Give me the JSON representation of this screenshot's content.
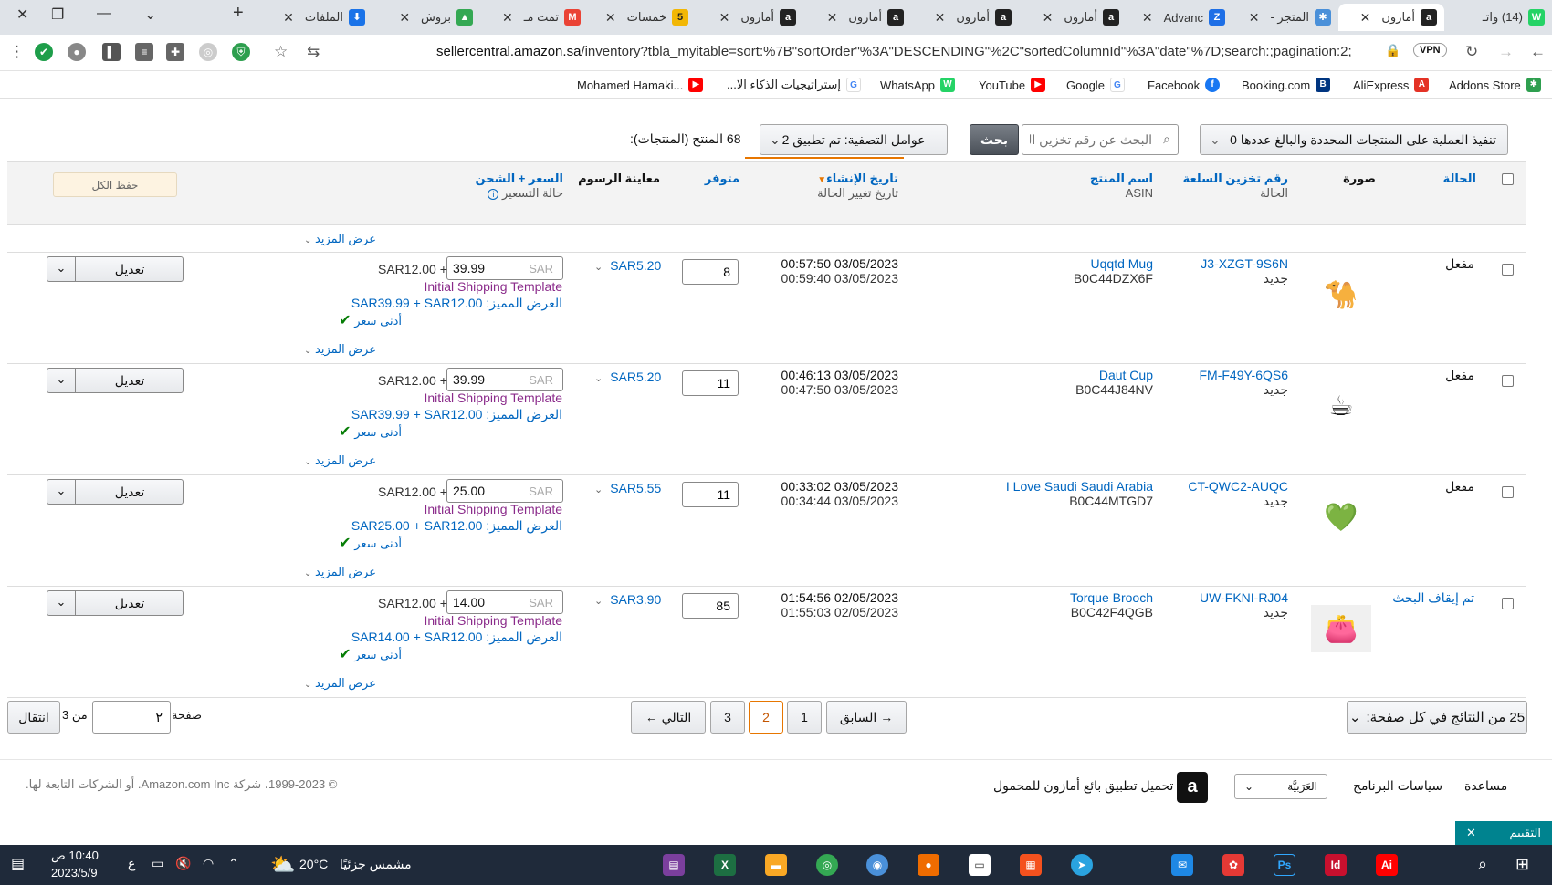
{
  "browser": {
    "tabs": [
      {
        "label": "(14) واتـ",
        "fav": "W"
      },
      {
        "label": "أمازون",
        "fav": "a"
      },
      {
        "label": "المتجر -",
        "fav": "✱"
      },
      {
        "label": "Advanc",
        "fav": "Z"
      },
      {
        "label": "أمازون",
        "fav": "a"
      },
      {
        "label": "أمازون",
        "fav": "a"
      },
      {
        "label": "أمازون",
        "fav": "a"
      },
      {
        "label": "أمازون",
        "fav": "a"
      },
      {
        "label": "خمسات",
        "fav": "5"
      },
      {
        "label": "تمت مـ",
        "fav": "M"
      },
      {
        "label": "بروش",
        "fav": "▲"
      },
      {
        "label": "الملفات",
        "fav": "⬇"
      }
    ],
    "url_domain": "sellercentral.amazon.sa",
    "url_path": "/inventory?tbla_myitable=sort:%7B\"sortOrder\"%3A\"DESCENDING\"%2C\"sortedColumnId\"%3A\"date\"%7D;search:;pagination:2;",
    "bookmarks": [
      "Addons Store",
      "AliExpress",
      "Booking.com",
      "Facebook",
      "Google",
      "YouTube",
      "WhatsApp",
      "إستراتيجيات الذكاء الا...",
      "Mohamed Hamaki..."
    ],
    "accent": "#0066c0"
  },
  "toolbar": {
    "bulk_action": "تنفيذ العملية على المنتجات المحددة والبالغ عددها 0",
    "search_placeholder": "البحث عن رقم تخزين السلعة",
    "search_button": "بحث",
    "filter_button": "عوامل التصفية: تم تطبيق 2",
    "count_text": "68 المنتج (المنتجات):"
  },
  "header": {
    "status": "الحالة",
    "image": "صورة",
    "sku": "رقم تخزين السلعة",
    "sku_sub": "الحالة",
    "name": "اسم المنتج",
    "name_sub": "ASIN",
    "created": "تاريخ الإنشاء",
    "created_sub": "تاريخ تغيير الحالة",
    "available": "متوفر",
    "fee_preview": "معاينة الرسوم",
    "price_ship": "السعر + الشحن",
    "price_status": "حالة التسعير",
    "save_all": "حفظ الكل"
  },
  "top_show_more": "عرض المزيد",
  "rows": [
    {
      "status": "مفعل",
      "sku": "J3-XZGT-9S6N",
      "condition": "جديد",
      "name": "Uqqtd Mug",
      "asin": "B0C44DZX6F",
      "created": "00:57:50 03/05/2023",
      "changed": "00:59:40 03/05/2023",
      "qty": "8",
      "fee": "SAR5.20",
      "price": "39.99",
      "currency": "SAR",
      "shipping": "SAR12.00 +",
      "template": "Initial Shipping Template",
      "featured": "العرض المميز: SAR39.99 + SAR12.00",
      "lowest": "أدنى سعر",
      "edit": "تعديل",
      "more": "عرض المزيد",
      "thumb": "🐪"
    },
    {
      "status": "مفعل",
      "sku": "FM-F49Y-6QS6",
      "condition": "جديد",
      "name": "Daut Cup",
      "asin": "B0C44J84NV",
      "created": "00:46:13 03/05/2023",
      "changed": "00:47:50 03/05/2023",
      "qty": "11",
      "fee": "SAR5.20",
      "price": "39.99",
      "currency": "SAR",
      "shipping": "SAR12.00 +",
      "template": "Initial Shipping Template",
      "featured": "العرض المميز: SAR39.99 + SAR12.00",
      "lowest": "أدنى سعر",
      "edit": "تعديل",
      "more": "عرض المزيد",
      "thumb": "☕"
    },
    {
      "status": "مفعل",
      "sku": "CT-QWC2-AUQC",
      "condition": "جديد",
      "name": "I Love Saudi Saudi Arabia",
      "asin": "B0C44MTGD7",
      "created": "00:33:02 03/05/2023",
      "changed": "00:34:44 03/05/2023",
      "qty": "11",
      "fee": "SAR5.55",
      "price": "25.00",
      "currency": "SAR",
      "shipping": "SAR12.00 +",
      "template": "Initial Shipping Template",
      "featured": "العرض المميز: SAR25.00 + SAR12.00",
      "lowest": "أدنى سعر",
      "edit": "تعديل",
      "more": "عرض المزيد",
      "thumb": "💚"
    },
    {
      "status": "تم إيقاف البحث",
      "sku": "UW-FKNI-RJ04",
      "condition": "جديد",
      "name": "Torque Brooch",
      "asin": "B0C42F4QGB",
      "created": "01:54:56 02/05/2023",
      "changed": "01:55:03 02/05/2023",
      "qty": "85",
      "fee": "SAR3.90",
      "price": "14.00",
      "currency": "SAR",
      "shipping": "SAR12.00 +",
      "template": "Initial Shipping Template",
      "featured": "العرض المميز: SAR14.00 + SAR12.00",
      "lowest": "أدنى سعر",
      "edit": "تعديل",
      "more": "عرض المزيد",
      "thumb": "👛"
    }
  ],
  "pagination": {
    "per_page": "25 من النتائج في كل صفحة:",
    "prev": "السابق",
    "pages": [
      "1",
      "2",
      "3"
    ],
    "current": "2",
    "next": "التالي",
    "page_label": "صفحة",
    "page_value": "٢",
    "of_label": "من 3",
    "go": "انتقال"
  },
  "footer": {
    "help": "مساعدة",
    "policies": "سياسات البرنامج",
    "language": "العَرَبيَّة",
    "app": "تحميل تطبيق بائع أمازون للمحمول",
    "copyright": "© 1999-2023، شركة Amazon.com Inc. أو الشركات التابعة لها.",
    "rate": "التقييم"
  },
  "taskbar": {
    "weather_text": "مشمس جزئيًا",
    "temp": "20°C",
    "time": "10:40 ص",
    "date": "2023/5/9",
    "lang": "ع"
  }
}
